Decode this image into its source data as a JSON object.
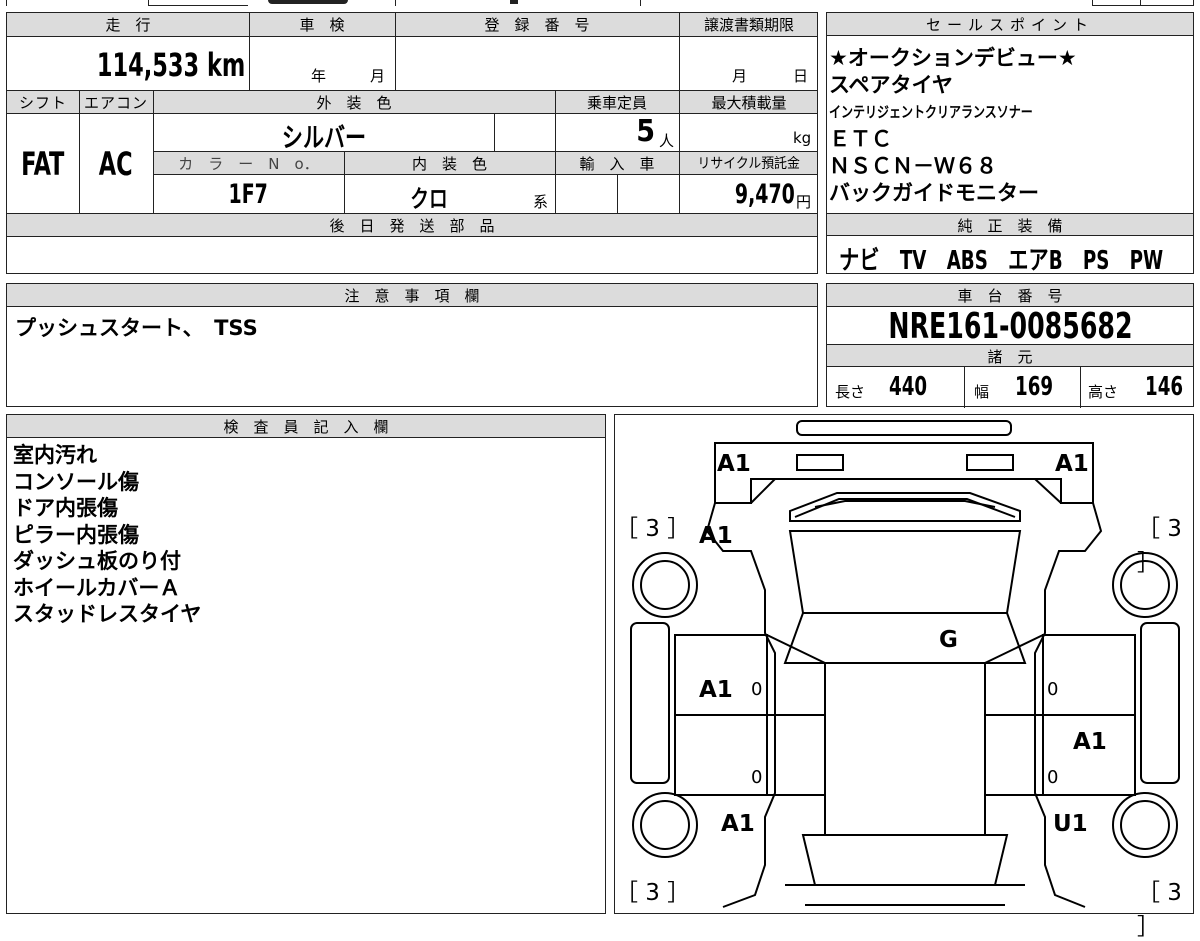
{
  "row1_headers": {
    "mileage": "走　行",
    "inspection": "車　検",
    "registration": "登　録　番　号",
    "transfer_deadline": "譲渡書類期限",
    "sales_points": "セールスポイント"
  },
  "mileage_value": "114,533 km",
  "inspection": {
    "year_unit": "年",
    "month_unit": "月"
  },
  "transfer": {
    "month_unit": "月",
    "day_unit": "日"
  },
  "row2_headers": {
    "shift": "シフト",
    "aircon": "エアコン",
    "exterior_color": "外　装　色",
    "capacity": "乗車定員",
    "max_load": "最大積載量"
  },
  "shift_value": "FAT",
  "aircon_value": "AC",
  "exterior_color_value": "シルバー",
  "capacity_value": "5",
  "capacity_unit": "人",
  "max_load_unit": "kg",
  "row3_headers": {
    "color_no": "カ　ラ　ー　N　o．",
    "interior_color": "内　装　色",
    "import": "輸　入　車",
    "recycle": "リサイクル預託金"
  },
  "color_no_value": "1F7",
  "interior_color_value": "クロ",
  "interior_color_suffix": "系",
  "recycle_value": "9,470",
  "recycle_unit": "円",
  "later_parts_header": "後　日　発　送　部　品",
  "sales_points": [
    "★オークションデビュー★",
    "スペアタイヤ",
    "インテリジェントクリアランスソナー",
    "ＥＴＣ",
    "ＮＳＣＮ－Ｗ６８",
    "バックガイドモニター"
  ],
  "genuine_equipment_header": "純　正　装　備",
  "genuine_equipment": "ナビ　TV　ABS　エアB　PS　PW",
  "notes_header": "注　意　事　項　欄",
  "notes_text": "プッシュスタート、　TSS",
  "chassis_header": "車　台　番　号",
  "chassis_number": "NRE161-0085682",
  "specs_header": "諸　元",
  "specs": {
    "length_label": "長さ",
    "length_value": "440",
    "width_label": "幅",
    "width_value": "169",
    "height_label": "高さ",
    "height_value": "146"
  },
  "inspector_header": "検　査　員　記　入　欄",
  "inspector_items": [
    "室内汚れ",
    "コンソール傷",
    "ドア内張傷",
    "ピラー内張傷",
    "ダッシュ板のり付",
    "ホイールカバーＡ",
    "スタッドレスタイヤ"
  ],
  "diagram_marks": {
    "front_left": "A1",
    "front_right": "A1",
    "fender_left": "A1",
    "hood": "G",
    "front_door_left": "A1",
    "rear_door_right": "A1",
    "rear_left": "A1",
    "rear_right": "U1",
    "tire_fl": "［ 3 ］",
    "tire_fr": "［ 3 ］",
    "tire_rl": "［ 3 ］",
    "tire_rr": "［ 3 ］",
    "door_fl_small": "0",
    "door_rl_small": "0",
    "door_fr_small": "0",
    "door_rr_small": "0"
  }
}
